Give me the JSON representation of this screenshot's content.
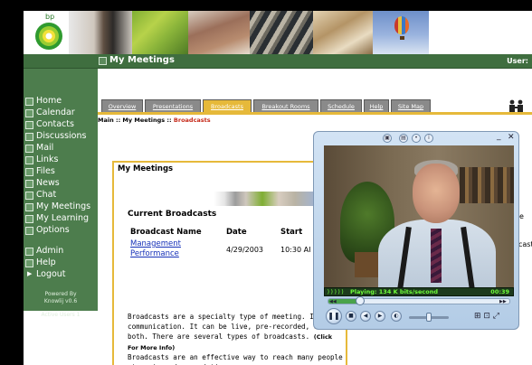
{
  "brand": {
    "logo_text": "bp"
  },
  "banner": {
    "photos": [
      "portrait-photo",
      "world-map-photo",
      "landscape-photo",
      "machinery-photo",
      "handshake-photo",
      "hot-air-balloon-photo"
    ]
  },
  "header": {
    "title": "My Meetings",
    "user_label": "User:"
  },
  "sidebar": {
    "items": [
      {
        "label": "Home"
      },
      {
        "label": "Calendar"
      },
      {
        "label": "Contacts"
      },
      {
        "label": "Discussions"
      },
      {
        "label": "Mail"
      },
      {
        "label": "Links"
      },
      {
        "label": "Files"
      },
      {
        "label": "News"
      },
      {
        "label": "Chat"
      },
      {
        "label": "My Meetings"
      },
      {
        "label": "My Learning"
      },
      {
        "label": "Options"
      }
    ],
    "admin_items": [
      {
        "label": "Admin"
      },
      {
        "label": "Help"
      }
    ],
    "logout": "Logout",
    "powered_line1": "Powered By",
    "powered_line2": "Knowlij v0.6",
    "active_users": "Active Users 1"
  },
  "tabs": [
    {
      "label": "Overview",
      "active": false
    },
    {
      "label": "Presentations",
      "active": false
    },
    {
      "label": "Broadcasts",
      "active": true
    },
    {
      "label": "Breakout Rooms",
      "active": false
    },
    {
      "label": "Schedule",
      "active": false
    },
    {
      "label": "Help",
      "active": false
    },
    {
      "label": "Site Map",
      "active": false
    }
  ],
  "breadcrumb": {
    "path": "Main :: My Meetings :: ",
    "current": "Broadcasts"
  },
  "panel": {
    "title": "My Meetings",
    "section_title": "Current Broadcasts",
    "columns": [
      "Broadcast Name",
      "Date",
      "Start"
    ],
    "rows": [
      {
        "name": "Management Performance",
        "date": "4/29/2003",
        "start": "10:30 AI"
      }
    ],
    "para1": "Broadcasts are a specialty type of meeting. It is communication. It can be live, pre-recorded, or a both. There are several types of broadcasts.",
    "para1_more": "(Click For More Info)",
    "para2": "Broadcasts are an effective way to reach many people at various days and times."
  },
  "edge_text": {
    "line1": "e",
    "line2": "cast"
  },
  "player": {
    "status_bars": ")))))",
    "status_text": "Playing: 134 K bits/second",
    "time": "00:39",
    "seek_progress": 0.18,
    "volume_level": 0.5,
    "colors": {
      "frame": "#b3cce6",
      "status_bg": "#1d3a1d",
      "status_fg": "#6fff3a"
    }
  },
  "colors": {
    "sidebar": "#4d7d4d",
    "titlebar": "#3f6e3f",
    "accent": "#e6b93a",
    "tab": "#8a8a8a",
    "link": "#1530b8",
    "breadcrumb_current": "#c62a1a"
  }
}
